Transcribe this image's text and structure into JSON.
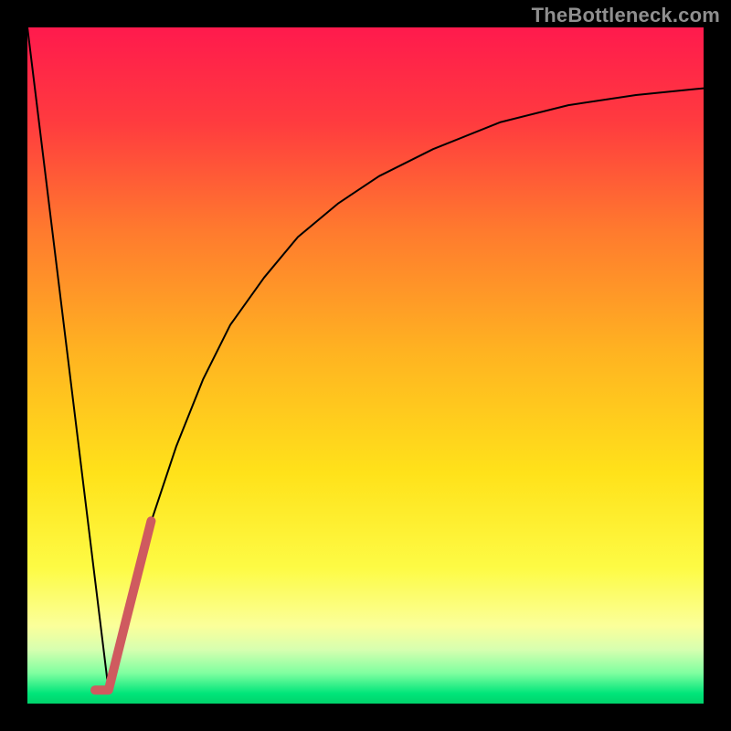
{
  "watermark": "TheBottleneck.com",
  "chart_data": {
    "type": "line",
    "title": "",
    "xlabel": "",
    "ylabel": "",
    "xlim": [
      0,
      100
    ],
    "ylim": [
      0,
      100
    ],
    "grid": false,
    "series": [
      {
        "name": "left-line",
        "color": "#000000",
        "stroke_width": 2,
        "x": [
          0,
          12
        ],
        "values": [
          100,
          2
        ]
      },
      {
        "name": "right-curve",
        "color": "#000000",
        "stroke_width": 2,
        "x": [
          12,
          15,
          18,
          22,
          26,
          30,
          35,
          40,
          46,
          52,
          60,
          70,
          80,
          90,
          100
        ],
        "values": [
          2,
          14,
          26,
          38,
          48,
          56,
          63,
          69,
          74,
          78,
          82,
          86,
          88.5,
          90,
          91
        ]
      },
      {
        "name": "highlight-tick",
        "color": "#cf5a5f",
        "stroke_width": 10,
        "x": [
          10,
          12,
          14.5,
          18.3
        ],
        "values": [
          2,
          2,
          12,
          27
        ]
      }
    ],
    "background_gradient": {
      "stops": [
        {
          "offset": 0.0,
          "color": "#ff1a4d"
        },
        {
          "offset": 0.14,
          "color": "#ff3b3f"
        },
        {
          "offset": 0.3,
          "color": "#ff7a2e"
        },
        {
          "offset": 0.48,
          "color": "#ffb321"
        },
        {
          "offset": 0.66,
          "color": "#ffe21a"
        },
        {
          "offset": 0.8,
          "color": "#fdfb45"
        },
        {
          "offset": 0.885,
          "color": "#fbff9a"
        },
        {
          "offset": 0.92,
          "color": "#d7ffb0"
        },
        {
          "offset": 0.955,
          "color": "#7fffa0"
        },
        {
          "offset": 0.985,
          "color": "#00e57a"
        },
        {
          "offset": 1.0,
          "color": "#00d36b"
        }
      ]
    }
  }
}
